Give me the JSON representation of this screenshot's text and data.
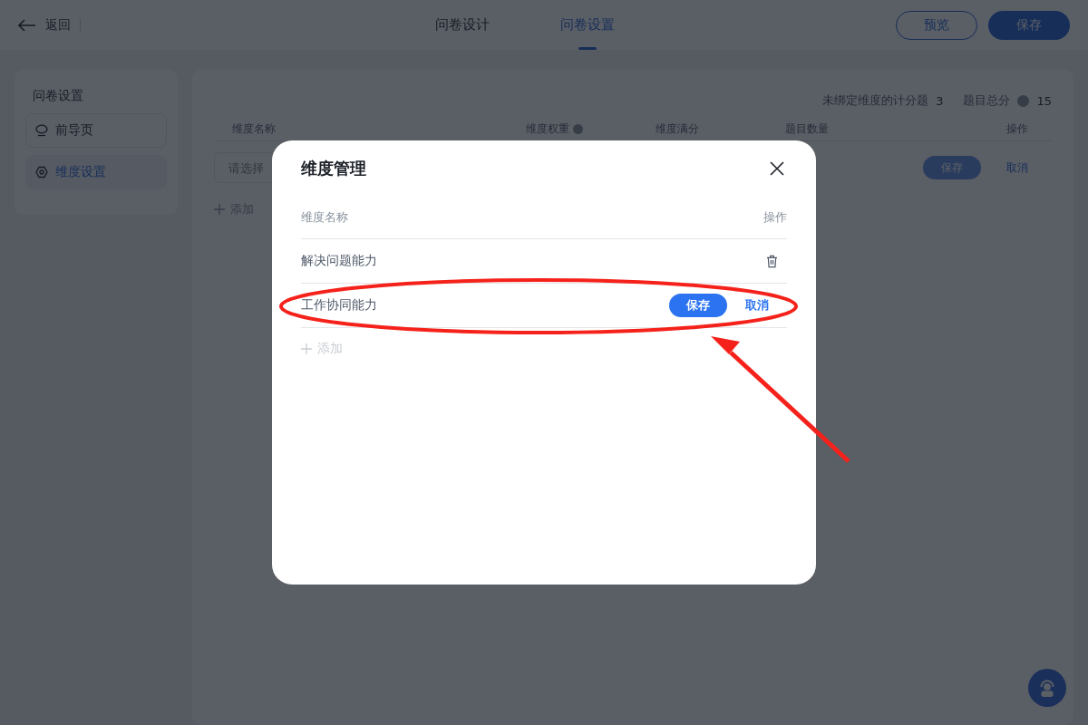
{
  "header": {
    "back_label": "返回",
    "tabs": [
      {
        "label": "问卷设计",
        "selected": false
      },
      {
        "label": "问卷设置",
        "selected": true
      }
    ],
    "preview_button": "预览",
    "save_button": "保存"
  },
  "sidebar": {
    "title": "问卷设置",
    "items": [
      {
        "label": "前导页",
        "selected": false
      },
      {
        "label": "维度设置",
        "selected": true
      }
    ]
  },
  "summary": {
    "unbound_label": "未绑定维度的计分题",
    "unbound_value": "3",
    "total_label": "题目总分",
    "total_value": "15"
  },
  "table": {
    "columns": [
      {
        "label": "维度名称",
        "help": false
      },
      {
        "label": "维度权重",
        "help": true
      },
      {
        "label": "维度满分",
        "help": false
      },
      {
        "label": "题目数量",
        "help": false
      },
      {
        "label": "操作",
        "help": false
      }
    ],
    "edit_row": {
      "placeholder": "请选择",
      "save": "保存",
      "cancel": "取消"
    },
    "add_label": "添加"
  },
  "modal": {
    "title": "维度管理",
    "columns": [
      "维度名称",
      "操作"
    ],
    "rows": [
      {
        "name": "解决问题能力",
        "editing": false
      },
      {
        "name": "工作协同能力",
        "editing": true,
        "save": "保存",
        "cancel": "取消"
      }
    ],
    "add": {
      "label": "添加",
      "disabled": true
    }
  }
}
